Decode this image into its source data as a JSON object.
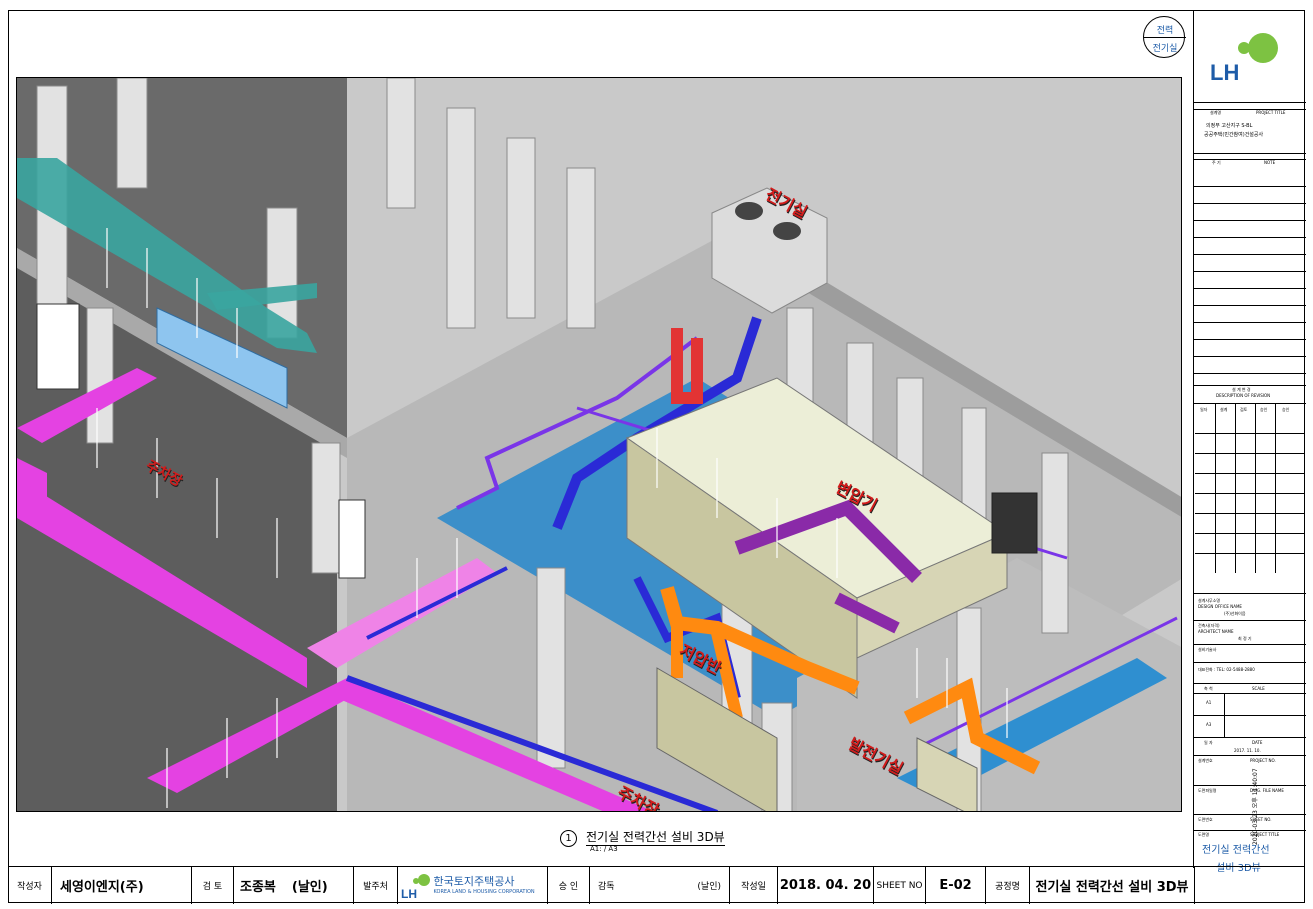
{
  "badge": {
    "line1": "전력",
    "line2": "전기실"
  },
  "logo": {
    "text": "LH",
    "brand_color": "#7dc242",
    "text_color": "#1e5ca8"
  },
  "caption": {
    "number": "1",
    "title": "전기실 전력간선 설비 3D뷰",
    "scale": "A1:   / A3"
  },
  "drawing_labels": {
    "top_room": "전기실",
    "room_left": "주차장",
    "room_center": "변압기",
    "room_mid": "저압반",
    "room_right": "발전기실",
    "room_bottom": "주차장"
  },
  "title_block": {
    "project_label_ko": "설계명",
    "project_label_en": "PROJECT TITLE",
    "project_line1": "의정부 고산지구 S-BL",
    "project_line2": "공공주택(민간참여)건설공사",
    "note_label_ko": "주 기",
    "note_label_en": "NOTE",
    "revision_ko": "설 계 변 경",
    "revision_en": "DESCRIPTION OF REVISION",
    "revision_cols": [
      "일자",
      "설계",
      "검토",
      "승인",
      "승인"
    ],
    "office_label": "설계사무소명",
    "office_label_en": "DESIGN OFFICE NAME",
    "office_name": "(주)선화이음",
    "architect_label": "건축사(자격)",
    "architect_label_en": "ARCHITECT NAME",
    "architect_name": "최 정 기",
    "design_label": "설비기술사",
    "contact": "대표전화 : TEL: 02-5488-2880",
    "scale_label_ko": "축 척",
    "scale_label_en": "SCALE",
    "scale_a1": "A1",
    "scale_a3": "A3",
    "date_label_ko": "일 자",
    "date_label_en": "DATE",
    "date_value": "2017.  11.  10.",
    "project_no_ko": "설계번호",
    "project_no_en": "PROJECT NO.",
    "file_ko": "도면파일명",
    "file_en": "DWG. FILE NAME",
    "sheet_ko": "도면번호",
    "sheet_en": "SHEET NO.",
    "subject_ko": "도면명",
    "subject_en": "SUBJECT TITLE",
    "subject_line1": "전기실 전력간선",
    "subject_line2": "설비 3D뷰"
  },
  "side_stamp": "2020-03-23 오후 11:40:07",
  "bottom": {
    "author_label": "작성자",
    "author": "세영이엔지(주)",
    "review_label": "검 토",
    "reviewer": "조종복",
    "reviewer_sign": "(날인)",
    "client_label": "발주처",
    "client_name_ko": "한국토지주택공사",
    "client_name_en": "KOREA LAND & HOUSING CORPORATION",
    "approve_label": "승 인",
    "supervise_label": "감독",
    "supervise_sign": "(날인)",
    "date_label": "작성일",
    "date": "2018. 04. 20",
    "sheet_label": "SHEET NO",
    "sheet_no": "E-02",
    "work_label": "공정명",
    "work_title": "전기실 전력간선 설비 3D뷰"
  }
}
